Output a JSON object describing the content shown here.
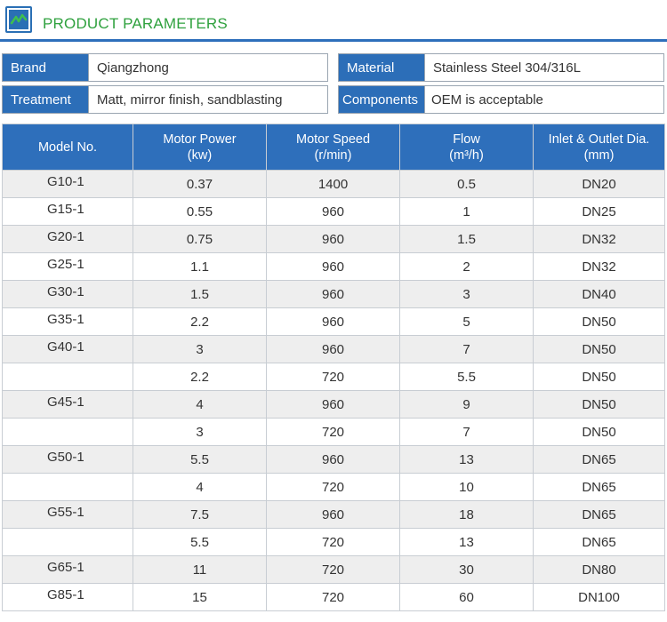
{
  "header": {
    "title": "PRODUCT PARAMETERS",
    "logo_icon": "pump-logo-icon",
    "accent": "#2e6fbb",
    "title_color": "#2fa13e"
  },
  "info": [
    {
      "label": "Brand",
      "value": "Qiangzhong"
    },
    {
      "label": "Material",
      "value": "Stainless Steel 304/316L"
    },
    {
      "label": "Treatment",
      "value": "Matt, mirror finish, sandblasting"
    },
    {
      "label": "Components",
      "value": "OEM is acceptable"
    }
  ],
  "table": {
    "headers": [
      {
        "line1": "Model No.",
        "line2": ""
      },
      {
        "line1": "Motor Power",
        "line2": "(kw)"
      },
      {
        "line1": "Motor Speed",
        "line2": "(r/min)"
      },
      {
        "line1": "Flow",
        "line2": "(m³/h)"
      },
      {
        "line1": "Inlet & Outlet Dia.",
        "line2": "(mm)"
      }
    ],
    "rows": [
      [
        "G10-1",
        "0.37",
        "1400",
        "0.5",
        "DN20"
      ],
      [
        "G15-1",
        "0.55",
        "960",
        "1",
        "DN25"
      ],
      [
        "G20-1",
        "0.75",
        "960",
        "1.5",
        "DN32"
      ],
      [
        "G25-1",
        "1.1",
        "960",
        "2",
        "DN32"
      ],
      [
        "G30-1",
        "1.5",
        "960",
        "3",
        "DN40"
      ],
      [
        "G35-1",
        "2.2",
        "960",
        "5",
        "DN50"
      ],
      [
        "G40-1",
        "3",
        "960",
        "7",
        "DN50"
      ],
      [
        "",
        "2.2",
        "720",
        "5.5",
        "DN50"
      ],
      [
        "G45-1",
        "4",
        "960",
        "9",
        "DN50"
      ],
      [
        "",
        "3",
        "720",
        "7",
        "DN50"
      ],
      [
        "G50-1",
        "5.5",
        "960",
        "13",
        "DN65"
      ],
      [
        "",
        "4",
        "720",
        "10",
        "DN65"
      ],
      [
        "G55-1",
        "7.5",
        "960",
        "18",
        "DN65"
      ],
      [
        "",
        "5.5",
        "720",
        "13",
        "DN65"
      ],
      [
        "G65-1",
        "11",
        "720",
        "30",
        "DN80"
      ],
      [
        "G85-1",
        "15",
        "720",
        "60",
        "DN100"
      ]
    ]
  }
}
